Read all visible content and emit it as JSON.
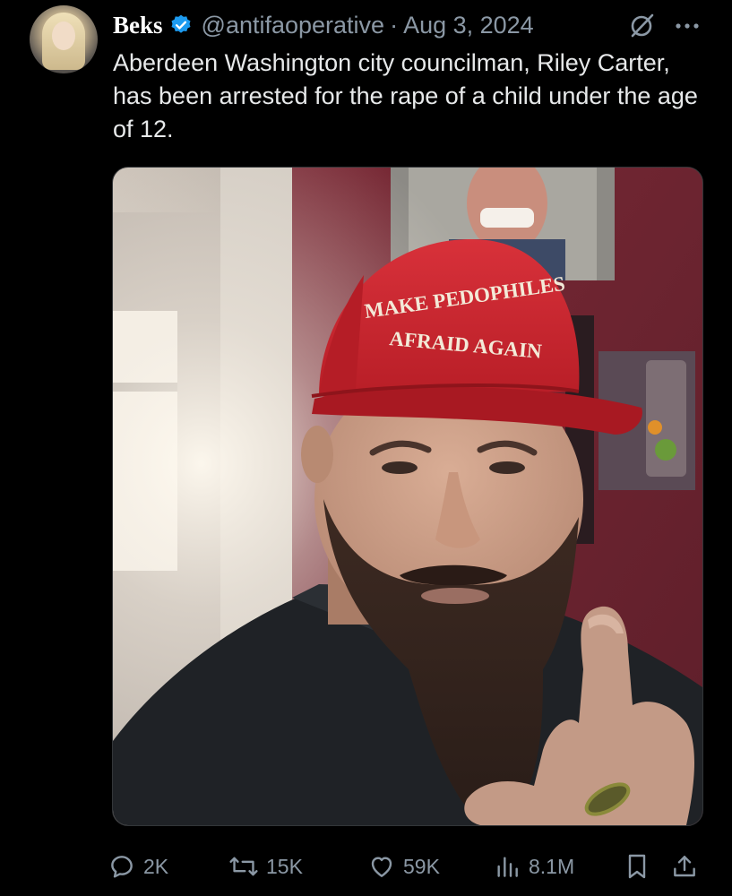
{
  "post": {
    "author": {
      "display_name": "Beks",
      "handle": "@antifaoperative",
      "verified": true
    },
    "separator": "·",
    "date": "Aug 3, 2024",
    "text": "Aberdeen Washington city councilman, Riley Carter, has been arrested for the rape of a child under the age of 12.",
    "media": {
      "cap_line_1": "MAKE PEDOPHILES",
      "cap_line_2": "AFRAID AGAIN"
    },
    "metrics": {
      "replies": "2K",
      "reposts": "15K",
      "likes": "59K",
      "views": "8.1M"
    }
  },
  "icons": {
    "avatar": "avatar",
    "verified": "verified-badge-icon",
    "grok": "grok-icon",
    "more": "more-icon",
    "reply": "reply-icon",
    "repost": "repost-icon",
    "like": "like-icon",
    "views": "views-icon",
    "bookmark": "bookmark-icon",
    "share": "share-icon"
  },
  "colors": {
    "background": "#000000",
    "text": "#e7e9ea",
    "secondary_text": "#8b98a5",
    "verified_blue": "#1d9bf0",
    "cap_red": "#c8202a"
  }
}
